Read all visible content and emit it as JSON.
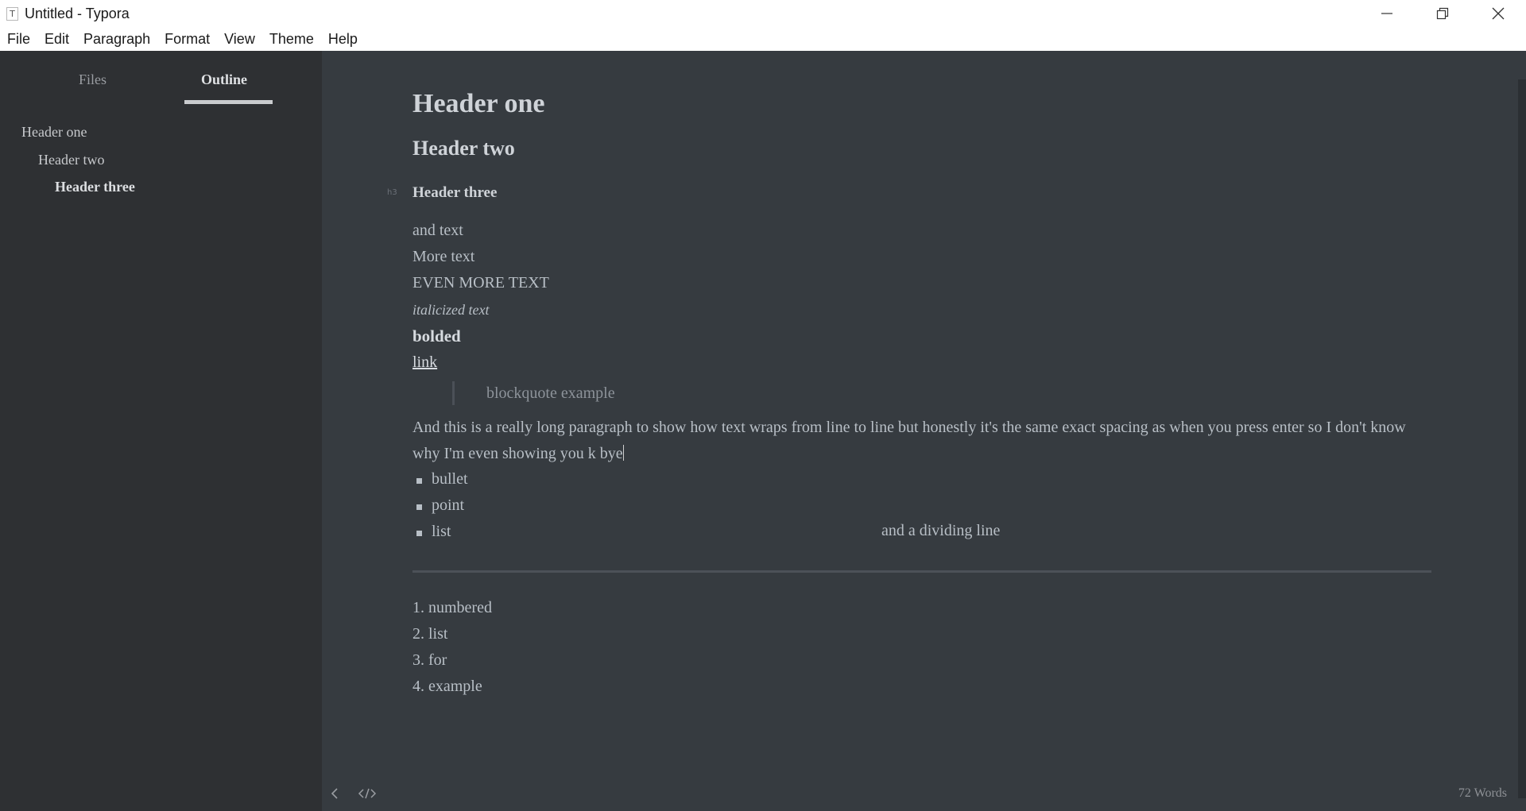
{
  "window": {
    "title": "Untitled - Typora",
    "app_icon_letter": "T"
  },
  "menu": [
    "File",
    "Edit",
    "Paragraph",
    "Format",
    "View",
    "Theme",
    "Help"
  ],
  "sidebar": {
    "tabs": {
      "files": "Files",
      "outline": "Outline"
    },
    "active_tab": "Outline",
    "outline": [
      "Header one",
      "Header two",
      "Header three"
    ]
  },
  "document": {
    "h1": "Header one",
    "h2": "Header two",
    "h3": "Header three",
    "h3_marker": "h3",
    "lines": {
      "text1": "and text",
      "text2": "More text",
      "text3": "EVEN MORE TEXT",
      "italic": "italicized text",
      "bold": "bolded",
      "link": "link"
    },
    "blockquote": "blockquote example",
    "paragraph": "And this is a really long paragraph to show how text wraps from line to line but honestly it's the same exact spacing as when you press enter so I don't know why I'm even showing you k bye",
    "bullets": [
      "bullet",
      "point",
      "list"
    ],
    "divider_note": "and a dividing line",
    "numbered": [
      {
        "num": "1.",
        "text": "numbered"
      },
      {
        "num": "2.",
        "text": "list"
      },
      {
        "num": "3.",
        "text": "for"
      },
      {
        "num": "4.",
        "text": "example"
      }
    ]
  },
  "status": {
    "word_count": "72 Words"
  }
}
